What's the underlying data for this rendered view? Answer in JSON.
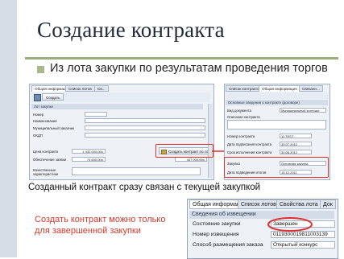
{
  "slide": {
    "title": "Создание контракта",
    "bullet": "Из лота закупки по результатам проведения торгов",
    "caption_linked": "Созданный контракт сразу связан с текущей закупкой",
    "caption_note": "Создать контракт можно только для завершенной закупки"
  },
  "left_window": {
    "tabs": [
      "Общая информация",
      "Список лотов",
      "Св..."
    ],
    "buttons": [
      "Создать"
    ],
    "section": "Лот закупки",
    "fields": [
      {
        "label": "Номер",
        "value": ""
      },
      {
        "label": "Наименование",
        "value": ""
      },
      {
        "label": "Муниципальный заказчик",
        "value": ""
      },
      {
        "label": "ОКДП",
        "value": ""
      },
      {
        "label": "Цена контракта",
        "value": "1 432 000,00р."
      },
      {
        "label": "Обеспечение заявки",
        "value": "74 600,00р."
      },
      {
        "label": "Качественные характеристики",
        "value": ""
      }
    ],
    "create_button": "Создать контракт по лоту",
    "amount": "447 000,00р."
  },
  "right_window": {
    "tabs": [
      "Список контрактов",
      "Общая информация",
      "Связанн..."
    ],
    "section": "Основные сведения о контракте (договоре)",
    "fields": [
      {
        "label": "Вид документа",
        "value": "Муниципальный контракт"
      },
      {
        "label": "Описание контракта",
        "value": ""
      },
      {
        "label": "Номер контракта",
        "value": "11 TEST"
      },
      {
        "label": "Дата подписания контракта",
        "value": "30.07.2012"
      },
      {
        "label": "Срок исполнения контракта",
        "value": "30.08.2012"
      },
      {
        "label": "Закупка",
        "value": "Основная закупка"
      },
      {
        "label": "Дата подведения итогов",
        "value": "15.12.2011"
      }
    ]
  },
  "panel": {
    "tabs": [
      "Общая информация",
      "Список лотов",
      "Свойства лота",
      "Док"
    ],
    "section": "Сведения об извещении",
    "rows": [
      {
        "label": "Состояние закупки",
        "value": "Завершен"
      },
      {
        "label": "Номер извещения",
        "value": "0119300019811003139"
      },
      {
        "label": "Способ размещения заказа",
        "value": "Открытый конкурс"
      }
    ]
  }
}
